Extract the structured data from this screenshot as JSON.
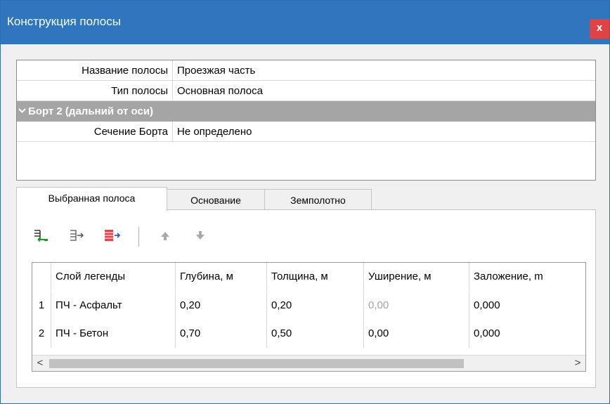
{
  "window": {
    "title": "Конструкция полосы",
    "close_label": "x"
  },
  "properties": {
    "rows": [
      {
        "name": "Название полосы",
        "value": "Проезжая часть"
      },
      {
        "name": "Тип полосы",
        "value": "Основная полоса"
      }
    ],
    "group": {
      "label": "Борт 2 (дальний от оси)",
      "expanded": true
    },
    "group_rows": [
      {
        "name": "Сечение Борта",
        "value": "Не определено"
      }
    ]
  },
  "tabs": [
    {
      "label": "Выбранная полоса",
      "active": true
    },
    {
      "label": "Основание",
      "active": false
    },
    {
      "label": "Земполотно",
      "active": false
    }
  ],
  "toolbar": {
    "buttons": [
      "insert-row-icon",
      "add-row-icon",
      "add-layer-icon",
      "move-up-icon",
      "move-down-icon"
    ]
  },
  "table": {
    "columns": [
      "",
      "Слой легенды",
      "Глубина, м",
      "Толщина, м",
      "Уширение, м",
      "Заложение, m"
    ],
    "rows": [
      {
        "n": "1",
        "layer": "ПЧ - Асфальт",
        "depth": "0,20",
        "thickness": "0,20",
        "widening": "0,00",
        "slope": "0,000"
      },
      {
        "n": "2",
        "layer": "ПЧ - Бетон",
        "depth": "0,70",
        "thickness": "0,50",
        "widening": "0,00",
        "slope": "0,000"
      }
    ]
  },
  "scrollbar": {
    "left_arrow": "<",
    "right_arrow": ">"
  },
  "colors": {
    "titlebar": "#2f76bf",
    "close": "#e04343",
    "group_header": "#a5a5a5"
  }
}
